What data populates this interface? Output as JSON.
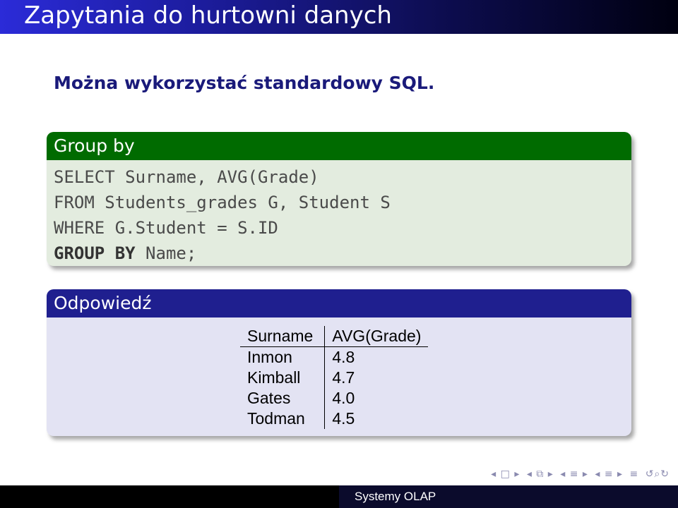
{
  "slide": {
    "title": "Zapytania do hurtowni danych",
    "intro": "Można wykorzystać standardowy SQL."
  },
  "block_group_by": {
    "heading": "Group by",
    "code": {
      "line1": "SELECT Surname, AVG(Grade)",
      "line2": "FROM Students_grades G, Student S",
      "line3": "WHERE G.Student = S.ID",
      "line4_keyword": "GROUP BY",
      "line4_rest": " Name;"
    }
  },
  "block_answer": {
    "heading": "Odpowiedź",
    "table": {
      "headers": [
        "Surname",
        "AVG(Grade)"
      ],
      "rows": [
        [
          "Inmon",
          "4.8"
        ],
        [
          "Kimball",
          "4.7"
        ],
        [
          "Gates",
          "4.0"
        ],
        [
          "Todman",
          "4.5"
        ]
      ]
    }
  },
  "footer": {
    "text": "Systemy OLAP"
  },
  "colors": {
    "title_bar": "#1c1c9c",
    "group_by_header": "#006b00",
    "answer_header": "#1f1f8f",
    "intro_text": "#1a1a7a"
  },
  "nav_icons": [
    "nav-prev-frame-icon",
    "nav-slide-icon",
    "nav-prev-slide-icon",
    "nav-subsection-icon",
    "nav-section-icon",
    "nav-align-icon",
    "nav-search-icon"
  ]
}
